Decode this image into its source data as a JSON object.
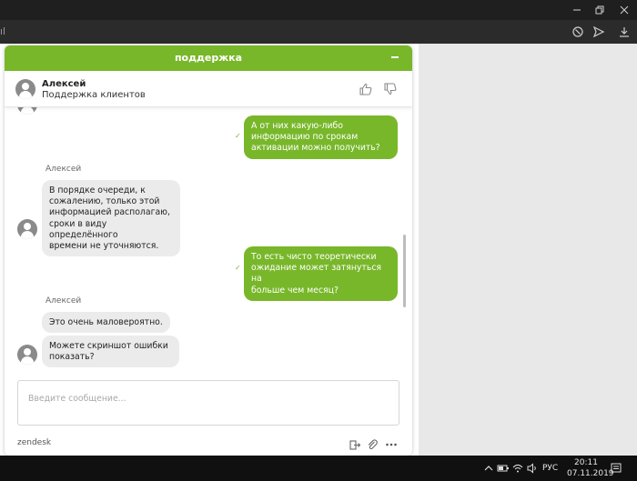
{
  "browser": {
    "address_fragment": "ıl"
  },
  "widget": {
    "header_title": "поддержка",
    "agent": {
      "name": "Алексей",
      "role": "Поддержка клиентов"
    },
    "messages": [
      {
        "from": "user",
        "text": "А от них какую-либо\nинформацию по срокам\nактивации можно получить?"
      },
      {
        "from": "agent",
        "sender": "Алексей",
        "text": "В порядке очереди, к\nсожалению, только этой\nинформацией располагаю,\nсроки в виду определённого\nвремени не уточняются."
      },
      {
        "from": "user",
        "text": "То есть чисто теоретически\nожидание может затянуться на\nбольше чем месяц?"
      },
      {
        "from": "agent",
        "sender": "Алексей",
        "text": "Это очень маловероятно."
      },
      {
        "from": "agent",
        "text": "Можете скриншот ошибки\nпоказать?"
      }
    ],
    "composer_placeholder": "Введите сообщение...",
    "brand": "zendesk"
  },
  "taskbar": {
    "language": "РУС",
    "time": "20:11",
    "date": "07.11.2019"
  },
  "colors": {
    "accent": "#78b72a",
    "incoming_bubble": "#ebebeb",
    "taskbar": "#101010"
  }
}
